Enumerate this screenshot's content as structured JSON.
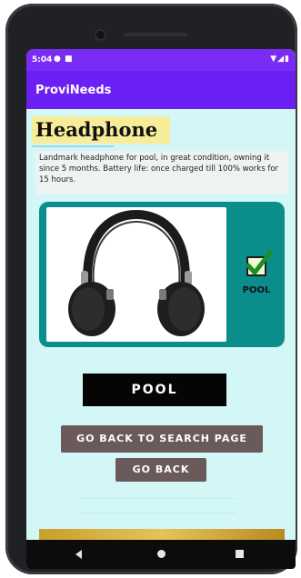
{
  "status_bar": {
    "time": "5:04",
    "icons": [
      "settings-icon",
      "notification-icon"
    ],
    "right_icons": [
      "wifi-icon",
      "signal-icon",
      "battery-icon"
    ]
  },
  "app_bar": {
    "title": "ProviNeeds"
  },
  "product": {
    "name": "Headphone",
    "description": "Landmark headphone for pool, in great condition, owning it since 5 months. Battery life: once charged till 100% works for 15 hours.",
    "image": "headphones-image",
    "badge_label": "POOL",
    "badge_icon": "checkmark-icon"
  },
  "actions": {
    "pool_label": "POOL",
    "search_label": "GO BACK TO SEARCH PAGE",
    "back_label": "GO BACK"
  },
  "nav": {
    "icons": [
      "back-triangle-icon",
      "home-circle-icon",
      "recents-square-icon"
    ]
  },
  "colors": {
    "app_bar": "#6b1ff3",
    "screen_bg": "#d3f7f6",
    "card": "#0b8d8b",
    "heading_highlight": "#f6ec9a",
    "secondary_button": "#6b5a5c"
  }
}
